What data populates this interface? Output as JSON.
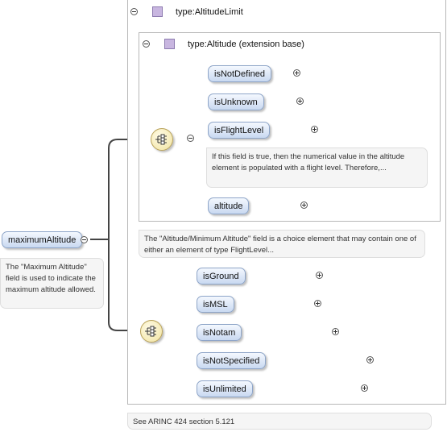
{
  "root": {
    "name": "maximumAltitude",
    "note": "The \"Maximum Altitude\" field is used to indicate the maximum altitude allowed."
  },
  "type_box": {
    "title": "type:AltitudeLimit"
  },
  "ext_box": {
    "title": "type:Altitude (extension base)",
    "elements": [
      "isNotDefined",
      "isUnknown",
      "isFlightLevel",
      "altitude"
    ],
    "flight_level_note": "If this field is true, then the numerical value in the altitude element is populated with a flight level. Therefore,..."
  },
  "choice_note": "The \"Altitude/Minimum Altitude\" field is a choice element that may contain one of either an element of type FlightLevel...",
  "choice2_elements": [
    "isGround",
    "isMSL",
    "isNotam",
    "isNotSpecified",
    "isUnlimited"
  ],
  "footer_note": "See ARINC 424 section 5.121"
}
